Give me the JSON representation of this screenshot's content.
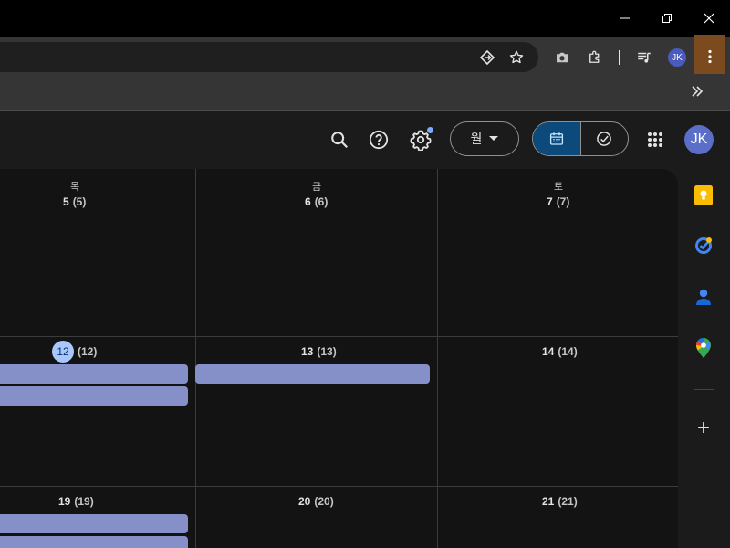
{
  "browser": {
    "profile_initials": "JK",
    "window_controls": {
      "minimize": "minimize-icon",
      "restore": "restore-icon",
      "close": "close-icon"
    }
  },
  "header": {
    "view_select_label": "월",
    "avatar_initials": "JK",
    "accent_color": "#0b4a7a"
  },
  "calendar": {
    "weekdays": [
      "목",
      "금",
      "토"
    ],
    "weeks": [
      {
        "days": [
          {
            "day": "5",
            "lunar": "(5)"
          },
          {
            "day": "6",
            "lunar": "(6)"
          },
          {
            "day": "7",
            "lunar": "(7)"
          }
        ]
      },
      {
        "days": [
          {
            "day": "12",
            "lunar": "(12)",
            "today": true
          },
          {
            "day": "13",
            "lunar": "(13)"
          },
          {
            "day": "14",
            "lunar": "(14)"
          }
        ]
      },
      {
        "days": [
          {
            "day": "19",
            "lunar": "(19)"
          },
          {
            "day": "20",
            "lunar": "(20)"
          },
          {
            "day": "21",
            "lunar": "(21)"
          }
        ]
      }
    ],
    "event_color": "#8590c8",
    "today_color": "#a8c7fa"
  },
  "side_panel": {
    "apps": [
      "keep-icon",
      "tasks-icon",
      "contacts-icon",
      "maps-icon"
    ],
    "add_label": "+"
  }
}
